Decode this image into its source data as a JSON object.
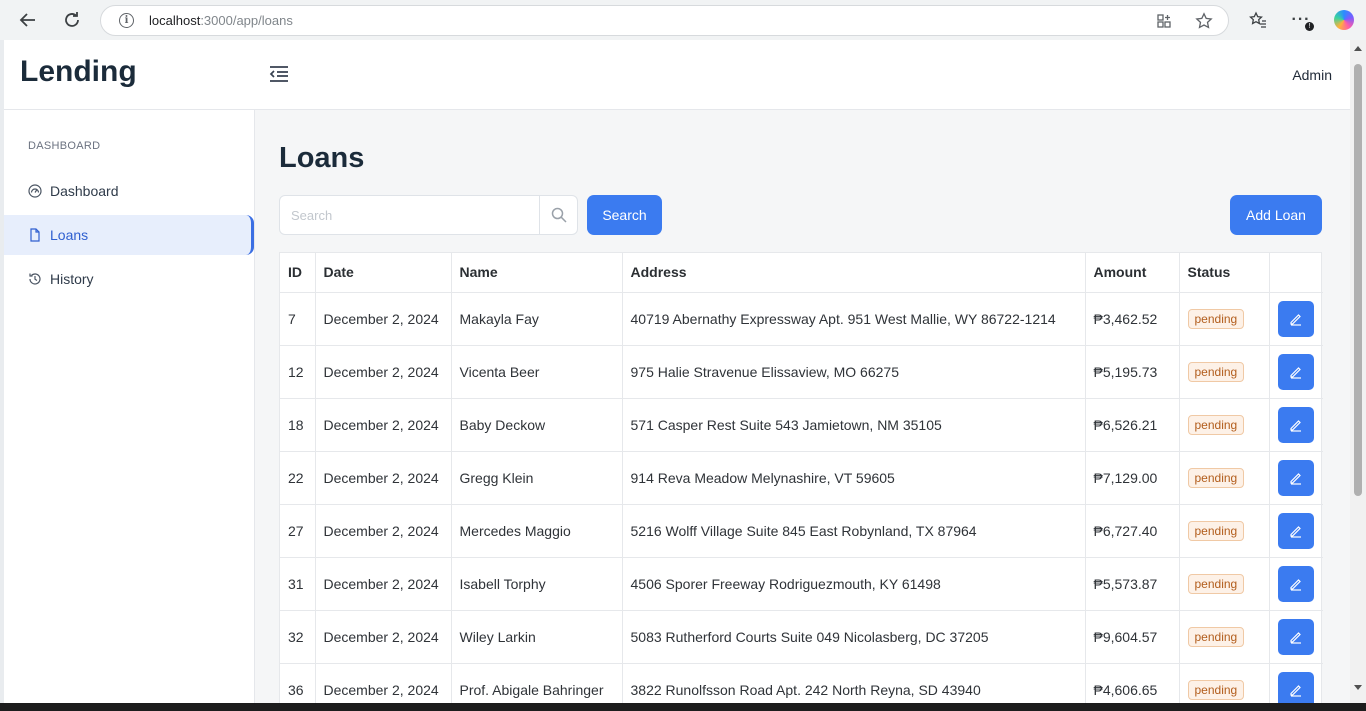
{
  "browser": {
    "url_host": "localhost",
    "url_path": ":3000/app/loans"
  },
  "app": {
    "brand": "Lending",
    "user": "Admin"
  },
  "sidebar": {
    "heading": "DASHBOARD",
    "items": [
      {
        "label": "Dashboard",
        "icon": "gauge-icon"
      },
      {
        "label": "Loans",
        "icon": "document-icon",
        "active": true
      },
      {
        "label": "History",
        "icon": "history-icon"
      }
    ]
  },
  "main": {
    "title": "Loans",
    "search_placeholder": "Search",
    "search_button": "Search",
    "add_button": "Add Loan"
  },
  "table": {
    "headers": [
      "ID",
      "Date",
      "Name",
      "Address",
      "Amount",
      "Status",
      ""
    ],
    "rows": [
      {
        "id": "7",
        "date": "December 2, 2024",
        "name": "Makayla Fay",
        "address": "40719 Abernathy Expressway Apt. 951 West Mallie, WY 86722-1214",
        "amount": "₱3,462.52",
        "status": "pending"
      },
      {
        "id": "12",
        "date": "December 2, 2024",
        "name": "Vicenta Beer",
        "address": "975 Halie Stravenue Elissaview, MO 66275",
        "amount": "₱5,195.73",
        "status": "pending"
      },
      {
        "id": "18",
        "date": "December 2, 2024",
        "name": "Baby Deckow",
        "address": "571 Casper Rest Suite 543 Jamietown, NM 35105",
        "amount": "₱6,526.21",
        "status": "pending"
      },
      {
        "id": "22",
        "date": "December 2, 2024",
        "name": "Gregg Klein",
        "address": "914 Reva Meadow Melynashire, VT 59605",
        "amount": "₱7,129.00",
        "status": "pending"
      },
      {
        "id": "27",
        "date": "December 2, 2024",
        "name": "Mercedes Maggio",
        "address": "5216 Wolff Village Suite 845 East Robynland, TX 87964",
        "amount": "₱6,727.40",
        "status": "pending"
      },
      {
        "id": "31",
        "date": "December 2, 2024",
        "name": "Isabell Torphy",
        "address": "4506 Sporer Freeway Rodriguezmouth, KY 61498",
        "amount": "₱5,573.87",
        "status": "pending"
      },
      {
        "id": "32",
        "date": "December 2, 2024",
        "name": "Wiley Larkin",
        "address": "5083 Rutherford Courts Suite 049 Nicolasberg, DC 37205",
        "amount": "₱9,604.57",
        "status": "pending"
      },
      {
        "id": "36",
        "date": "December 2, 2024",
        "name": "Prof. Abigale Bahringer",
        "address": "3822 Runolfsson Road Apt. 242 North Reyna, SD 43940",
        "amount": "₱4,606.65",
        "status": "pending"
      }
    ]
  },
  "colors": {
    "accent": "#3b7bf0",
    "status_pending": "#b25d1c"
  }
}
